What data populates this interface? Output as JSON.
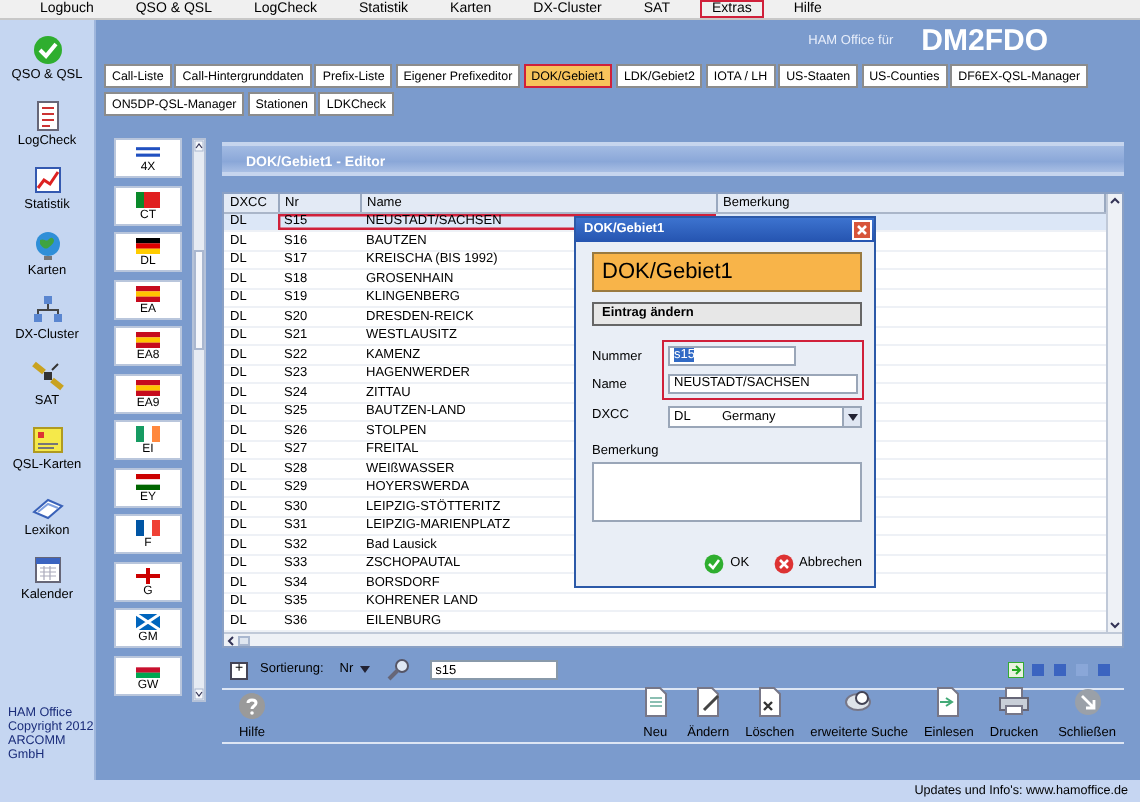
{
  "menu": [
    {
      "label": "Logbuch",
      "highlighted": false
    },
    {
      "label": "QSO & QSL",
      "highlighted": false
    },
    {
      "label": "LogCheck",
      "highlighted": false
    },
    {
      "label": "Statistik",
      "highlighted": false
    },
    {
      "label": "Karten",
      "highlighted": false
    },
    {
      "label": "DX-Cluster",
      "highlighted": false
    },
    {
      "label": "SAT",
      "highlighted": false
    },
    {
      "label": "Extras",
      "highlighted": true
    },
    {
      "label": "Hilfe",
      "highlighted": false
    }
  ],
  "sidebar": {
    "items": [
      {
        "label": "QSO & QSL"
      },
      {
        "label": "LogCheck"
      },
      {
        "label": "Statistik"
      },
      {
        "label": "Karten"
      },
      {
        "label": "DX-Cluster"
      },
      {
        "label": "SAT"
      },
      {
        "label": "QSL-Karten"
      },
      {
        "label": "Lexikon"
      },
      {
        "label": "Kalender"
      }
    ],
    "footer": [
      "HAM Office",
      "Copyright 2012",
      "ARCOMM GmbH"
    ]
  },
  "header": {
    "caption": "HAM Office für",
    "callsign": "DM2FDO"
  },
  "tabs": [
    {
      "label": "Call-Liste",
      "selected": false,
      "highlighted": false
    },
    {
      "label": "Call-Hintergrunddaten",
      "selected": false,
      "highlighted": false
    },
    {
      "label": "Prefix-Liste",
      "selected": false,
      "highlighted": false
    },
    {
      "label": "Eigener Prefixeditor",
      "selected": false,
      "highlighted": false
    },
    {
      "label": "DOK/Gebiet1",
      "selected": true,
      "highlighted": true
    },
    {
      "label": "LDK/Gebiet2",
      "selected": false,
      "highlighted": false
    },
    {
      "label": "IOTA / LH",
      "selected": false,
      "highlighted": false
    },
    {
      "label": "US-Staaten",
      "selected": false,
      "highlighted": false
    },
    {
      "label": "US-Counties",
      "selected": false,
      "highlighted": false
    },
    {
      "label": "DF6EX-QSL-Manager",
      "selected": false,
      "highlighted": false
    },
    {
      "label": "ON5DP-QSL-Manager",
      "selected": false,
      "highlighted": false
    },
    {
      "label": "Stationen",
      "selected": false,
      "highlighted": false
    },
    {
      "label": "LDKCheck",
      "selected": false,
      "highlighted": false
    }
  ],
  "flags": [
    {
      "label": "4X"
    },
    {
      "label": "CT"
    },
    {
      "label": "DL"
    },
    {
      "label": "EA"
    },
    {
      "label": "EA8"
    },
    {
      "label": "EA9"
    },
    {
      "label": "EI"
    },
    {
      "label": "EY"
    },
    {
      "label": "F"
    },
    {
      "label": "G"
    },
    {
      "label": "GM"
    },
    {
      "label": "GW"
    }
  ],
  "editor": {
    "title": "DOK/Gebiet1 - Editor",
    "columns": [
      "DXCC",
      "Nr",
      "Name",
      "Bemerkung"
    ],
    "rows": [
      {
        "dxcc": "DL",
        "nr": "S15",
        "name": "NEUSTADT/SACHSEN",
        "selected": true,
        "highlighted": true
      },
      {
        "dxcc": "DL",
        "nr": "S16",
        "name": "BAUTZEN",
        "selected": false,
        "highlighted": false
      },
      {
        "dxcc": "DL",
        "nr": "S17",
        "name": "KREISCHA (BIS 1992)",
        "selected": false,
        "highlighted": false
      },
      {
        "dxcc": "DL",
        "nr": "S18",
        "name": "GROSENHAIN",
        "selected": false,
        "highlighted": false
      },
      {
        "dxcc": "DL",
        "nr": "S19",
        "name": "KLINGENBERG",
        "selected": false,
        "highlighted": false
      },
      {
        "dxcc": "DL",
        "nr": "S20",
        "name": "DRESDEN-REICK",
        "selected": false,
        "highlighted": false
      },
      {
        "dxcc": "DL",
        "nr": "S21",
        "name": "WESTLAUSITZ",
        "selected": false,
        "highlighted": false
      },
      {
        "dxcc": "DL",
        "nr": "S22",
        "name": "KAMENZ",
        "selected": false,
        "highlighted": false
      },
      {
        "dxcc": "DL",
        "nr": "S23",
        "name": "HAGENWERDER",
        "selected": false,
        "highlighted": false
      },
      {
        "dxcc": "DL",
        "nr": "S24",
        "name": "ZITTAU",
        "selected": false,
        "highlighted": false
      },
      {
        "dxcc": "DL",
        "nr": "S25",
        "name": "BAUTZEN-LAND",
        "selected": false,
        "highlighted": false
      },
      {
        "dxcc": "DL",
        "nr": "S26",
        "name": "STOLPEN",
        "selected": false,
        "highlighted": false
      },
      {
        "dxcc": "DL",
        "nr": "S27",
        "name": "FREITAL",
        "selected": false,
        "highlighted": false
      },
      {
        "dxcc": "DL",
        "nr": "S28",
        "name": "WEIßWASSER",
        "selected": false,
        "highlighted": false
      },
      {
        "dxcc": "DL",
        "nr": "S29",
        "name": "HOYERSWERDA",
        "selected": false,
        "highlighted": false
      },
      {
        "dxcc": "DL",
        "nr": "S30",
        "name": "LEIPZIG-STÖTTERITZ",
        "selected": false,
        "highlighted": false
      },
      {
        "dxcc": "DL",
        "nr": "S31",
        "name": "LEIPZIG-MARIENPLATZ",
        "selected": false,
        "highlighted": false
      },
      {
        "dxcc": "DL",
        "nr": "S32",
        "name": "Bad Lausick",
        "selected": false,
        "highlighted": false
      },
      {
        "dxcc": "DL",
        "nr": "S33",
        "name": "ZSCHOPAUTAL",
        "selected": false,
        "highlighted": false
      },
      {
        "dxcc": "DL",
        "nr": "S34",
        "name": "BORSDORF",
        "selected": false,
        "highlighted": false
      },
      {
        "dxcc": "DL",
        "nr": "S35",
        "name": "KOHRENER LAND",
        "selected": false,
        "highlighted": false
      },
      {
        "dxcc": "DL",
        "nr": "S36",
        "name": "EILENBURG",
        "selected": false,
        "highlighted": false
      }
    ]
  },
  "sort": {
    "add": "+",
    "label": "Sortierung:",
    "value": "Nr",
    "search": "s15"
  },
  "toolbar": {
    "help": "Hilfe",
    "buttons": [
      "Neu",
      "Ändern",
      "Löschen",
      "erweiterte Suche",
      "Einlesen",
      "Drucken",
      "Schließen"
    ]
  },
  "dialog": {
    "title": "DOK/Gebiet1",
    "heading": "DOK/Gebiet1",
    "section": "Eintrag ändern",
    "number_label": "Nummer",
    "number": "s15",
    "name_label": "Name",
    "name": "NEUSTADT/SACHSEN",
    "dxcc_label": "DXCC",
    "dxcc_code": "DL",
    "dxcc_country": "Germany",
    "remark_label": "Bemerkung",
    "fields_highlighted": true,
    "ok": "OK",
    "cancel": "Abbrechen"
  },
  "status_bar": "Updates und Info's: www.hamoffice.de"
}
